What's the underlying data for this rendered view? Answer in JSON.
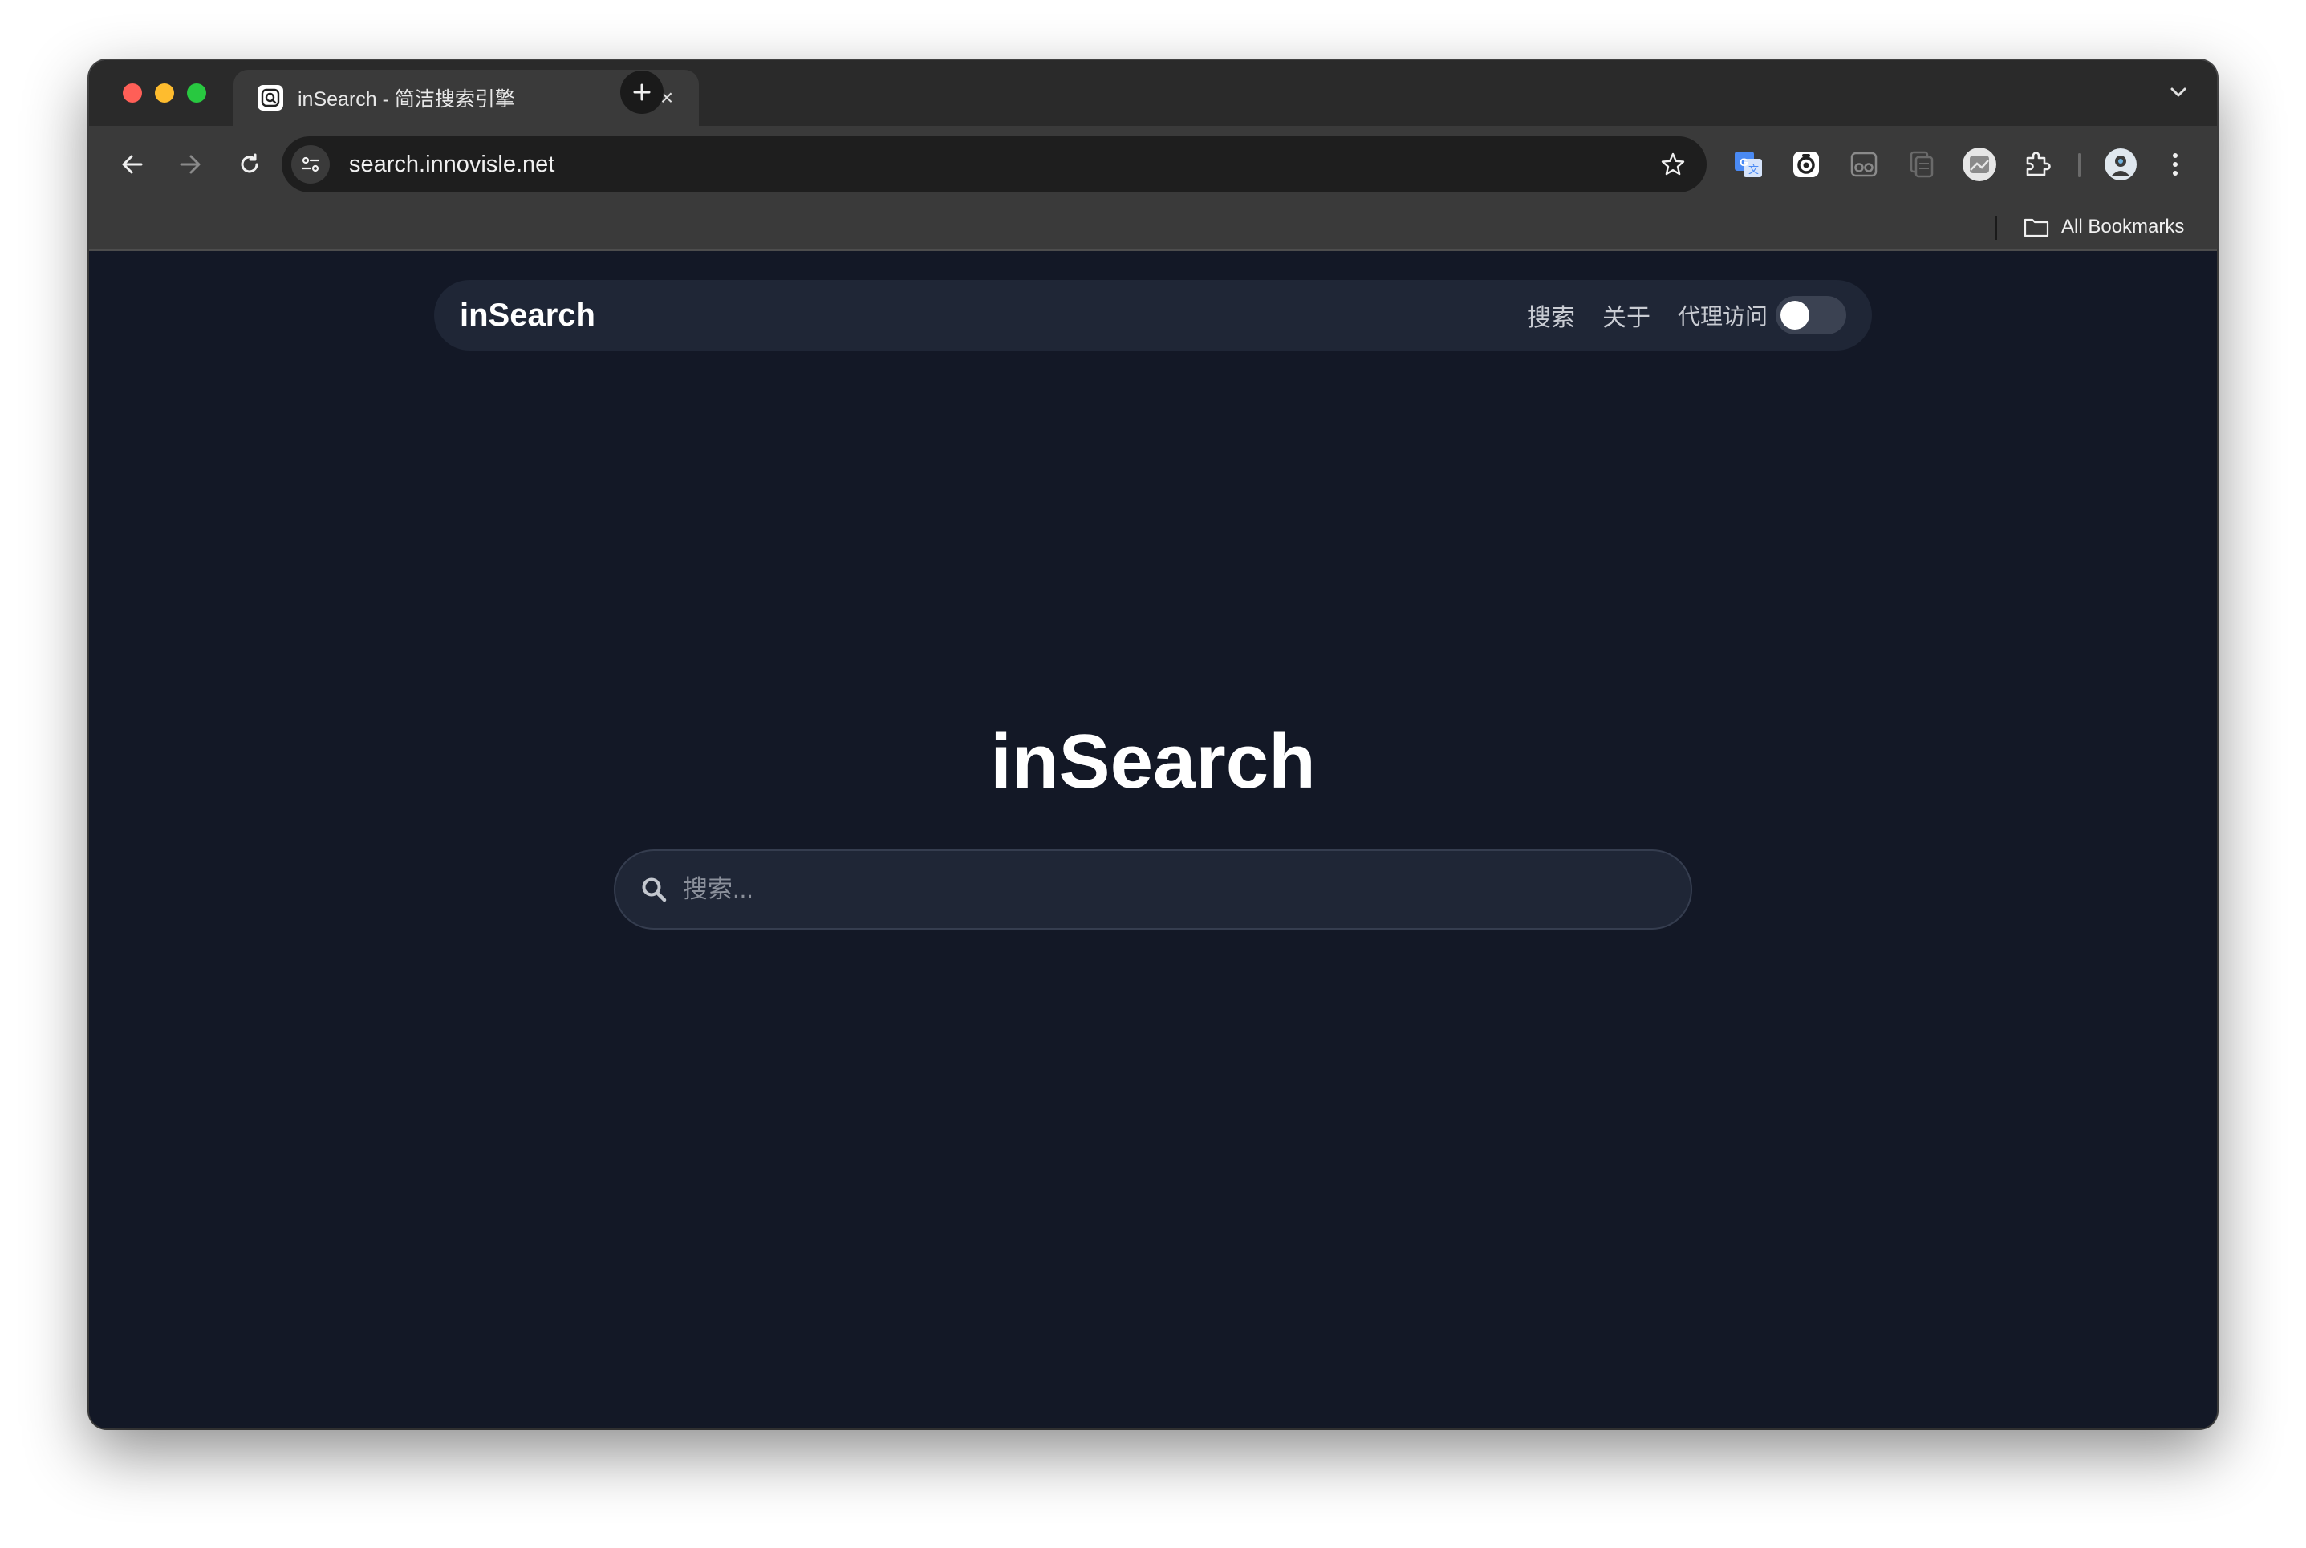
{
  "browser": {
    "tab": {
      "title": "inSearch - 简洁搜索引擎",
      "close_glyph": "×",
      "favicon": "insearch-favicon"
    },
    "new_tab_glyph": "+",
    "address": {
      "url": "search.innovisle.net"
    },
    "toolbar_icons": [
      "back-icon",
      "forward-icon",
      "reload-icon",
      "site-info-icon",
      "star-icon",
      "translate-icon",
      "screenshot-icon",
      "reader-icon",
      "copy-icon",
      "avatar-extension-icon",
      "extensions-icon",
      "profile-icon",
      "menu-icon"
    ],
    "bookmarks": {
      "all_label": "All Bookmarks"
    }
  },
  "page": {
    "navbar": {
      "brand": "inSearch",
      "links": [
        "搜索",
        "关于"
      ],
      "proxy_label": "代理访问",
      "proxy_enabled": false
    },
    "hero_title": "inSearch",
    "search": {
      "placeholder": "搜索...",
      "value": ""
    }
  },
  "colors": {
    "page_background": "#131826",
    "card_background": "#1f2636",
    "accent_text": "#ffffff"
  }
}
